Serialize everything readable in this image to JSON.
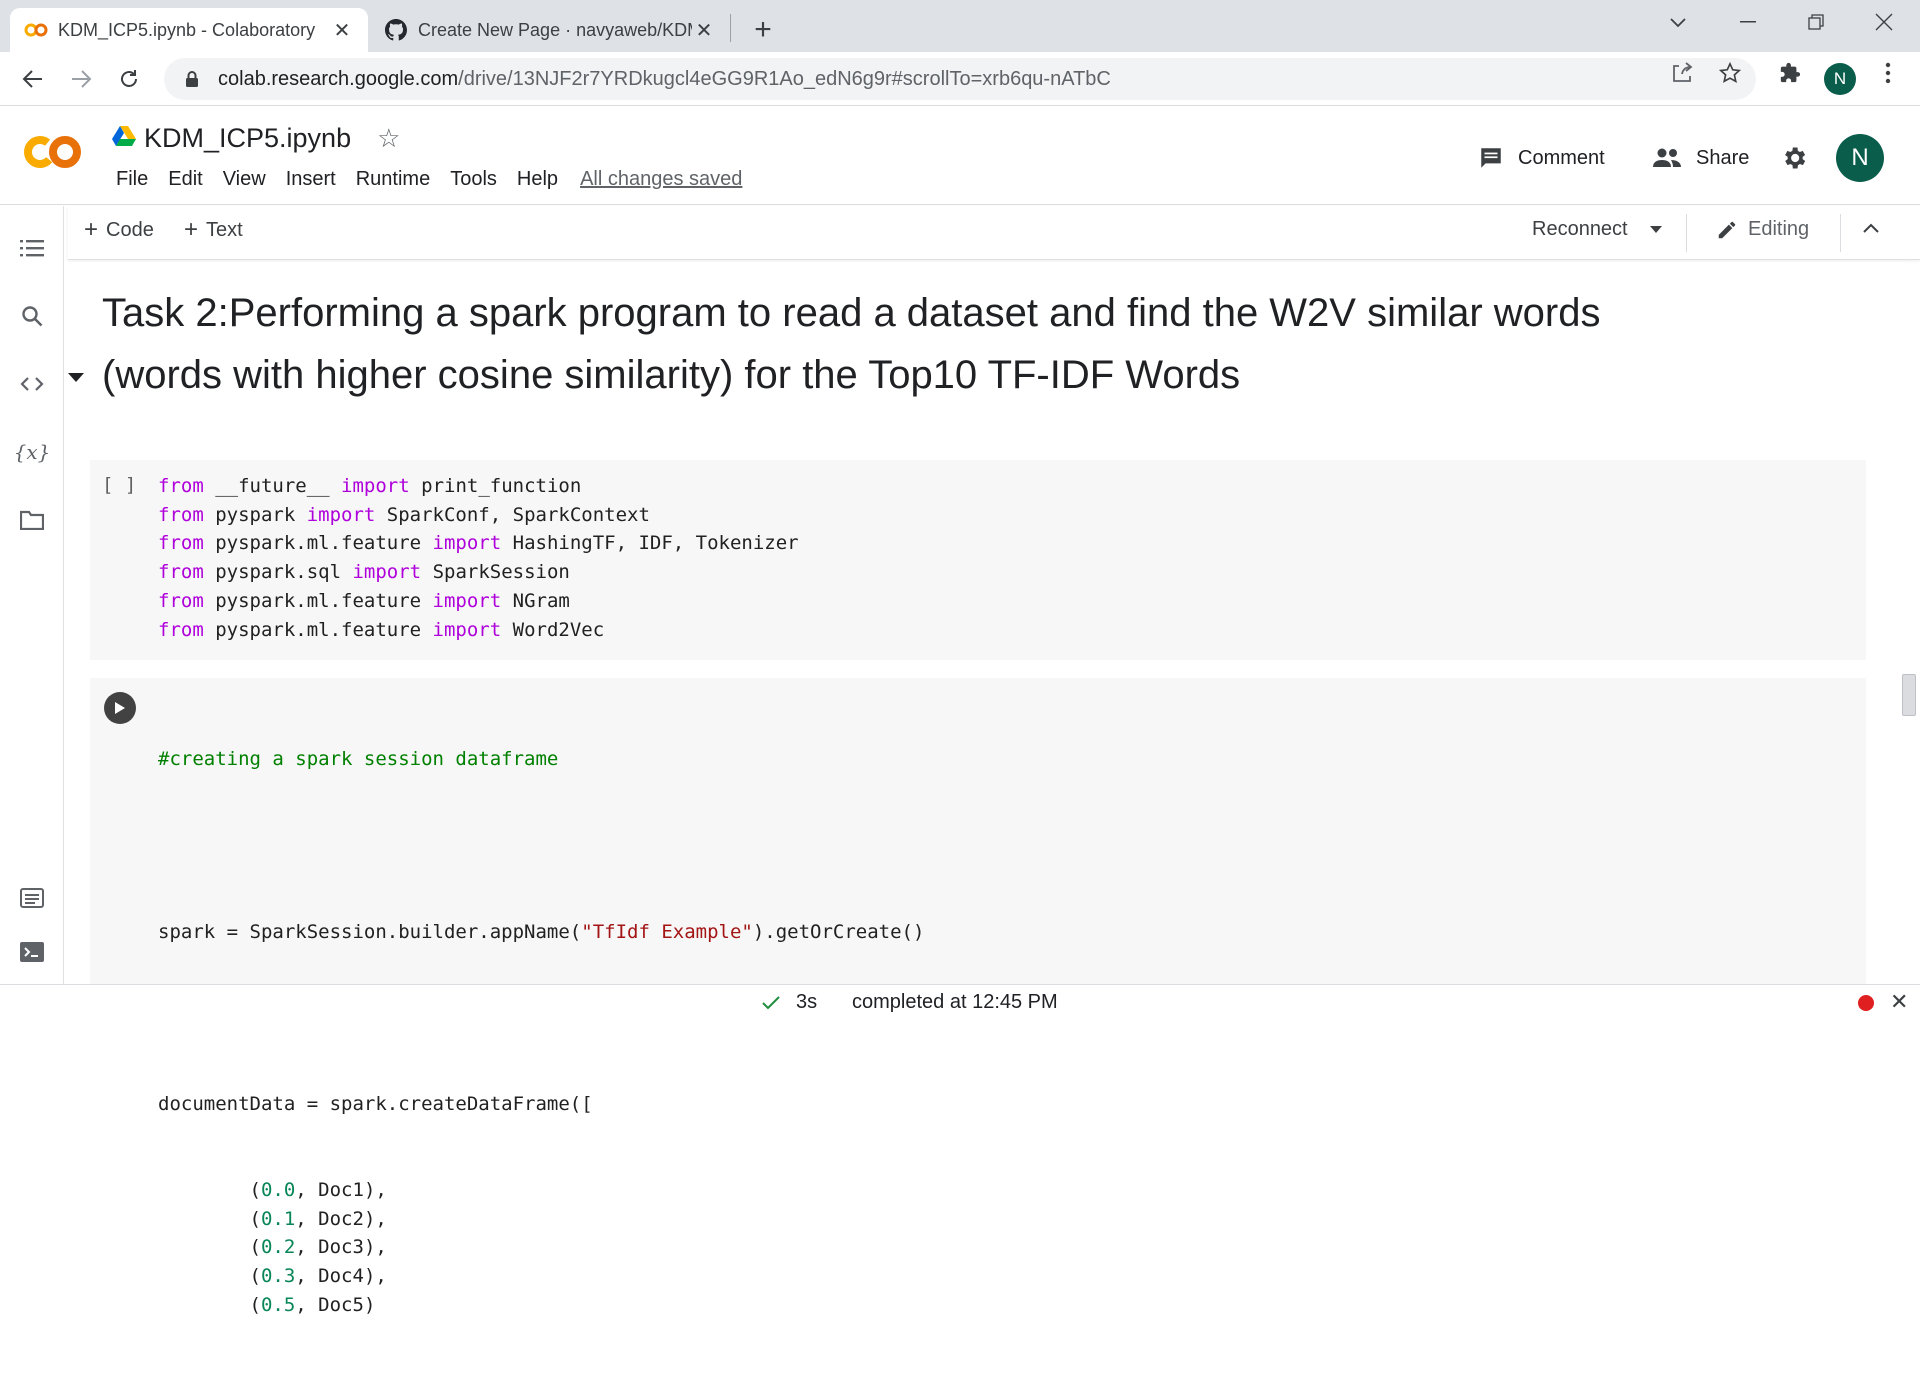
{
  "browser": {
    "tabs": [
      {
        "title": "KDM_ICP5.ipynb - Colaboratory",
        "active": true,
        "favicon": "colab-icon"
      },
      {
        "title": "Create New Page · navyaweb/KDM",
        "active": false,
        "favicon": "github-icon"
      }
    ],
    "url_host": "colab.research.google.com",
    "url_path": "/drive/13NJF2r7YRDkugcl4eGG9R1Ao_edN6g9r#scrollTo=xrb6qu-nATbC",
    "profile_initial": "N"
  },
  "colab": {
    "logo_text": "CO",
    "doc_title": "KDM_ICP5.ipynb",
    "menu": [
      "File",
      "Edit",
      "View",
      "Insert",
      "Runtime",
      "Tools",
      "Help"
    ],
    "save_status": "All changes saved",
    "comment_label": "Comment",
    "share_label": "Share",
    "avatar_initial": "N",
    "toolbar": {
      "add_code": "Code",
      "add_text": "Text",
      "reconnect": "Reconnect",
      "editing": "Editing"
    }
  },
  "notebook": {
    "heading_line1": "Task 2:Performing a spark program to read a dataset and find the W2V similar words",
    "heading_line2": "(words with higher cosine similarity) for the Top10 TF-IDF Words",
    "cell1_exec_label": "[ ]",
    "cell1_lines": [
      {
        "k1": "from",
        "m1": " __future__ ",
        "k2": "import",
        "m2": " print_function"
      },
      {
        "k1": "from",
        "m1": " pyspark ",
        "k2": "import",
        "m2": " SparkConf, SparkContext"
      },
      {
        "k1": "from",
        "m1": " pyspark.ml.feature ",
        "k2": "import",
        "m2": " HashingTF, IDF, Tokenizer"
      },
      {
        "k1": "from",
        "m1": " pyspark.sql ",
        "k2": "import",
        "m2": " SparkSession"
      },
      {
        "k1": "from",
        "m1": " pyspark.ml.feature ",
        "k2": "import",
        "m2": " NGram"
      },
      {
        "k1": "from",
        "m1": " pyspark.ml.feature ",
        "k2": "import",
        "m2": " Word2Vec"
      }
    ],
    "cell2": {
      "comment": "#creating a spark session dataframe",
      "spark_prefix": "spark = SparkSession.builder.appName(",
      "spark_string": "\"TfIdf Example\"",
      "spark_suffix": ").getOrCreate()",
      "df_line": "documentData = spark.createDataFrame([",
      "rows": [
        {
          "num": "0.0",
          "doc": "Doc1",
          "tail": "),"
        },
        {
          "num": "0.1",
          "doc": "Doc2",
          "tail": "),"
        },
        {
          "num": "0.2",
          "doc": "Doc3",
          "tail": "),"
        },
        {
          "num": "0.3",
          "doc": "Doc4",
          "tail": "),"
        },
        {
          "num": "0.5",
          "doc": "Doc5",
          "tail": ")"
        }
      ]
    }
  },
  "status": {
    "duration": "3s",
    "completed": "completed at 12:45 PM"
  },
  "colors": {
    "keyword": "#af00db",
    "comment": "#008000",
    "string": "#a31515",
    "number": "#098658",
    "colab_orange": "#f9ab00",
    "avatar_green": "#0b5d4b"
  }
}
